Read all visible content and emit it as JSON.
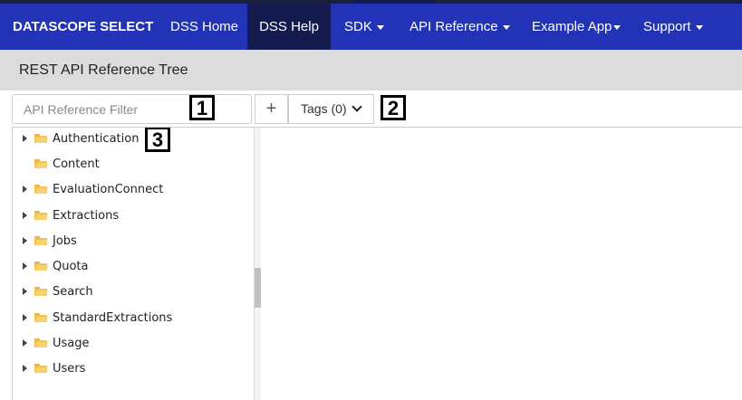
{
  "nav": {
    "brand": "DATASCOPE SELECT",
    "items": [
      {
        "label": "DSS Home",
        "dropdown": false
      },
      {
        "label": "DSS Help",
        "dropdown": false,
        "active": true
      },
      {
        "label": "SDK",
        "dropdown": true
      },
      {
        "label": "API Reference",
        "dropdown": true
      },
      {
        "label": "Example App",
        "dropdown": true
      },
      {
        "label": "Support",
        "dropdown": true
      }
    ]
  },
  "page": {
    "title": "REST API Reference Tree"
  },
  "toolbar": {
    "filter_placeholder": "API Reference Filter",
    "add_label": "+",
    "tags_label": "Tags (0)"
  },
  "callouts": [
    "1",
    "2",
    "3"
  ],
  "tree": {
    "items": [
      {
        "label": "Authentication",
        "expandable": true
      },
      {
        "label": "Content",
        "expandable": false
      },
      {
        "label": "EvaluationConnect",
        "expandable": true
      },
      {
        "label": "Extractions",
        "expandable": true
      },
      {
        "label": "Jobs",
        "expandable": true
      },
      {
        "label": "Quota",
        "expandable": true
      },
      {
        "label": "Search",
        "expandable": true
      },
      {
        "label": "StandardExtractions",
        "expandable": true
      },
      {
        "label": "Usage",
        "expandable": true
      },
      {
        "label": "Users",
        "expandable": true
      }
    ]
  },
  "colors": {
    "nav_bg": "#2333b7",
    "nav_active": "#141c4f",
    "subheader_bg": "#dcdcdc",
    "folder": "#f2c14e"
  }
}
